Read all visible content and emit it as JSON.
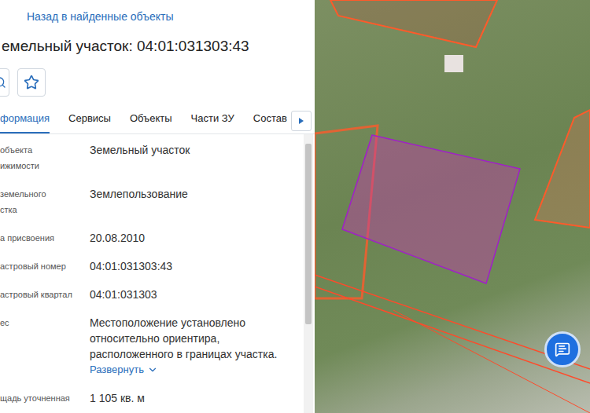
{
  "back_link": "Назад в найденные объекты",
  "title": "емельный участок: 04:01:031303:43",
  "tabs": [
    {
      "label": "формация",
      "selected": true
    },
    {
      "label": "Сервисы",
      "selected": false
    },
    {
      "label": "Объекты",
      "selected": false
    },
    {
      "label": "Части ЗУ",
      "selected": false
    },
    {
      "label": "Состав",
      "selected": false
    }
  ],
  "favorite": {
    "selected": false
  },
  "rows": [
    {
      "label": "объекта\nижимости",
      "value": "Земельный участок"
    },
    {
      "label": "земельного\nстка",
      "value": "Землепользование"
    },
    {
      "label": "а присвоения",
      "value": "20.08.2010"
    },
    {
      "label": "астровый номер",
      "value": "04:01:031303:43"
    },
    {
      "label": "астровый квартал",
      "value": "04:01:031303"
    },
    {
      "label": "ес",
      "value": "Местоположение установлено относительно ориентира, расположенного в границах участка.",
      "link": "Развернуть"
    },
    {
      "label": "щадь уточненная",
      "value": "1 105 кв. м"
    }
  ]
}
